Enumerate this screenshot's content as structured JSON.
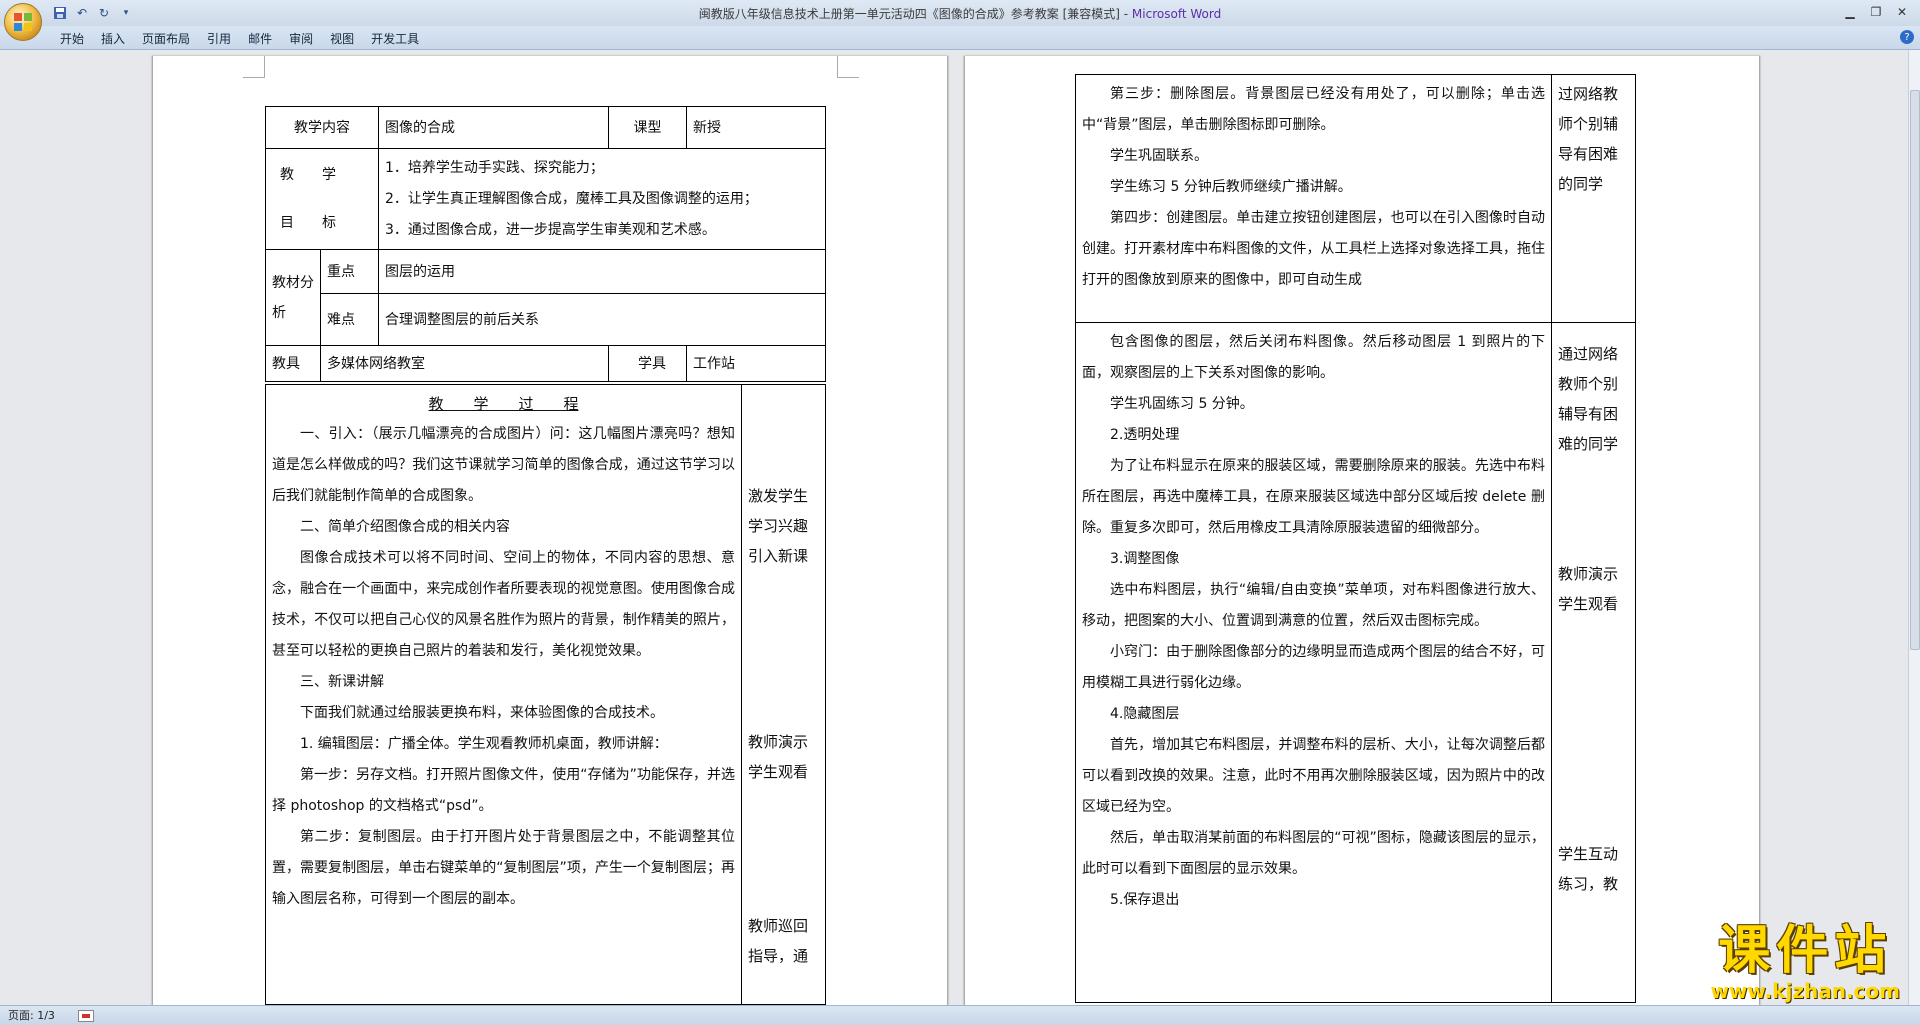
{
  "window": {
    "title": "闽教版八年级信息技术上册第一单元活动四《图像的合成》参考教案 [兼容模式] - ",
    "app_name": "Microsoft Word"
  },
  "ribbon": {
    "tabs": [
      "开始",
      "插入",
      "页面布局",
      "引用",
      "邮件",
      "审阅",
      "视图",
      "开发工具"
    ]
  },
  "status": {
    "page": "页面: 1/3"
  },
  "page1": {
    "header_table": {
      "content_label": "教学内容",
      "content_value": "图像的合成",
      "type_label": "课型",
      "type_value": "新授",
      "goal_label_1": "教　　学",
      "goal_label_2": "目　　标",
      "goals": [
        "1．培养学生动手实践、探究能力；",
        "2．让学生真正理解图像合成，魔棒工具及图像调整的运用；",
        "3．通过图像合成，进一步提高学生审美观和艺术感。"
      ],
      "analysis_label": "教材分析",
      "key_label": "重点",
      "key_value": "图层的运用",
      "difficulty_label": "难点",
      "difficulty_value": "合理调整图层的前后关系",
      "tools_label": "教具",
      "tools_value": "多媒体网络教室",
      "method_label": "学具",
      "method_value": "工作站"
    },
    "process_title": "教　　学　　过　　程",
    "paragraphs": [
      "一、引入：（展示几幅漂亮的合成图片）问：这几幅图片漂亮吗？想知道是怎么样做成的吗？我们这节课就学习简单的图像合成，通过这节学习以后我们就能制作简单的合成图象。",
      "二、简单介绍图像合成的相关内容",
      "图像合成技术可以将不同时间、空间上的物体，不同内容的思想、意念，融合在一个画面中，来完成创作者所要表现的视觉意图。使用图像合成技术，不仅可以把自己心仪的风景名胜作为照片的背景，制作精美的照片，甚至可以轻松的更换自己照片的着装和发行，美化视觉效果。",
      "三、新课讲解",
      "下面我们就通过给服装更换布料，来体验图像的合成技术。",
      "1. 编辑图层：广播全体。学生观看教师机桌面，教师讲解：",
      "第一步：另存文档。打开照片图像文件，使用“存储为”功能保存，并选择 photoshop 的文档格式“psd”。",
      "第二步：复制图层。由于打开图片处于背景图层之中，不能调整其位置，需要复制图层，单击右键菜单的“复制图层”项，产生一个复制图层；再输入图层名称，可得到一个图层的副本。"
    ],
    "side_notes": [
      "激发学生学习兴趣引入新课",
      "教师演示学生观看",
      "教师巡回指导，通"
    ]
  },
  "page2": {
    "block1": [
      "第三步：删除图层。背景图层已经没有用处了，可以删除；单击选中“背景”图层，单击删除图标即可删除。",
      "学生巩固联系。",
      "学生练习 5 分钟后教师继续广播讲解。",
      "第四步：创建图层。单击建立按钮创建图层，也可以在引入图像时自动创建。打开素材库中布料图像的文件，从工具栏上选择对象选择工具，拖住打开的图像放到原来的图像中，即可自动生成"
    ],
    "block1_side": "过网络教师个别辅导有困难的同学",
    "block2": [
      "包含图像的图层，然后关闭布料图像。然后移动图层 1 到照片的下面，观察图层的上下关系对图像的影响。",
      "学生巩固练习 5 分钟。",
      "2.透明处理",
      "为了让布料显示在原来的服装区域，需要删除原来的服装。先选中布料所在图层，再选中魔棒工具，在原来服装区域选中部分区域后按 delete 删除。重复多次即可，然后用橡皮工具清除原服装遗留的细微部分。",
      "3.调整图像",
      "选中布料图层，执行“编辑/自由变换”菜单项，对布料图像进行放大、移动，把图案的大小、位置调到满意的位置，然后双击图标完成。",
      "小窍门：由于删除图像部分的边缘明显而造成两个图层的结合不好，可用模糊工具进行弱化边缘。",
      "4.隐藏图层",
      "首先，增加其它布料图层，并调整布料的层析、大小，让每次调整后都可以看到改换的效果。注意，此时不用再次删除服装区域，因为照片中的改区域已经为空。",
      "然后，单击取消某前面的布料图层的“可视”图标，隐藏该图层的显示，此时可以看到下面图层的显示效果。",
      "5.保存退出"
    ],
    "block2_side": [
      "通过网络教师个别辅导有困难的同学",
      "教师演示学生观看",
      "学生互动练习，教"
    ]
  },
  "watermark": {
    "logo": "课件站",
    "url": "www.kjzhan.com"
  }
}
